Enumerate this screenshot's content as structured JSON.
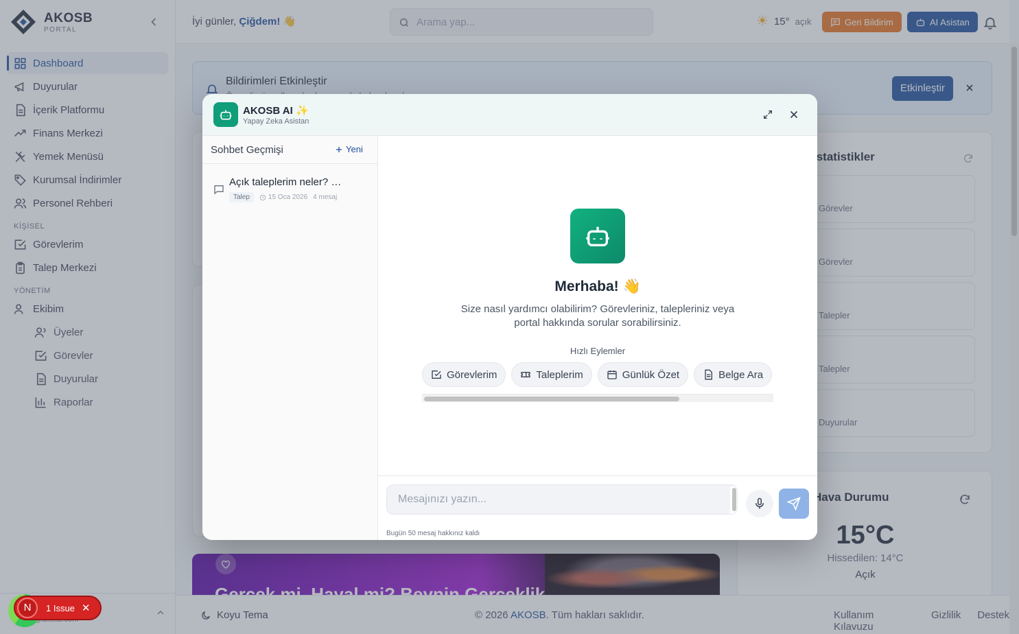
{
  "brand": {
    "name": "AKOSB",
    "sub": "PORTAL"
  },
  "sidebar": {
    "items": [
      {
        "label": "Dashboard"
      },
      {
        "label": "Duyurular"
      },
      {
        "label": "İçerik Platformu"
      },
      {
        "label": "Finans Merkezi"
      },
      {
        "label": "Yemek Menüsü"
      },
      {
        "label": "Kurumsal İndirimler"
      },
      {
        "label": "Personel Rehberi"
      }
    ],
    "section_personal": "KİŞİSEL",
    "personal": [
      {
        "label": "Görevlerim"
      },
      {
        "label": "Talep Merkezi"
      }
    ],
    "section_admin": "YÖNETİM",
    "admin_group": "Ekibim",
    "admin_sub": [
      {
        "label": "Üyeler"
      },
      {
        "label": "Görevler"
      },
      {
        "label": "Duyurular"
      },
      {
        "label": "Raporlar"
      }
    ],
    "user_name": "N",
    "user_email": "@akosb.com"
  },
  "topbar": {
    "greeting_prefix": "İyi günler,",
    "greeting_name": "Çiğdem!",
    "greeting_emoji": "👋",
    "search_placeholder": "Arama yap...",
    "temp": "15°",
    "condition": "açık",
    "feedback_label": "Geri Bildirim",
    "ai_label": "AI Asistan"
  },
  "banner": {
    "title": "Bildirimleri Etkinleştir",
    "subtitle": "Önemli güncellemelerden anında haberdar olun",
    "button": "Etkinleştir"
  },
  "stats": {
    "title": "İstatistikler",
    "rows": [
      "Görevler",
      "Görevler",
      "Talepler",
      "Talepler",
      "Duyurular"
    ]
  },
  "weather": {
    "title": "Hava Durumu",
    "temp": "15°C",
    "feels": "Hissedilen: 14°C",
    "condition": "Açık"
  },
  "promo": {
    "title": "Gerçek mi, Hayal mi? Beynin Gerçeklik"
  },
  "footer": {
    "theme": "Koyu Tema",
    "copy_prefix": "© 2026",
    "copy_brand": "AKOSB",
    "copy_suffix": ". Tüm hakları saklıdır.",
    "links": [
      "Kullanım Kılavuzu",
      "Gizlilik",
      "Destek"
    ]
  },
  "modal": {
    "title": "AKOSB AI",
    "subtitle": "Yapay Zeka Asistan",
    "history_title": "Sohbet Geçmişi",
    "new_label": "Yeni",
    "conversation": {
      "title": "Açık taleplerim neler? Detaylı bilgi ver",
      "tag": "Talep",
      "date": "15 Oca 2026",
      "count": "4 mesaj"
    },
    "hero_title": "Merhaba! 👋",
    "hero_desc": "Size nasıl yardımcı olabilirim? Görevleriniz, talepleriniz veya portal hakkında sorular sorabilirsiniz.",
    "quick_label": "Hızlı Eylemler",
    "quick_actions": [
      {
        "label": "Görevlerim",
        "icon": "check-square-icon"
      },
      {
        "label": "Taleplerim",
        "icon": "ticket-icon"
      },
      {
        "label": "Günlük Özet",
        "icon": "calendar-icon"
      },
      {
        "label": "Belge Ara",
        "icon": "document-icon"
      }
    ],
    "input_placeholder": "Mesajınızı yazın...",
    "quota": "Bugün 50 mesaj hakkınız kaldı"
  },
  "issue": {
    "badge": "N",
    "label": "1 Issue"
  },
  "colors": {
    "primary": "#1e4f9c",
    "accent_orange": "#e8711c",
    "ai_green": "#0f9d7a",
    "issue_red": "#d62424"
  }
}
